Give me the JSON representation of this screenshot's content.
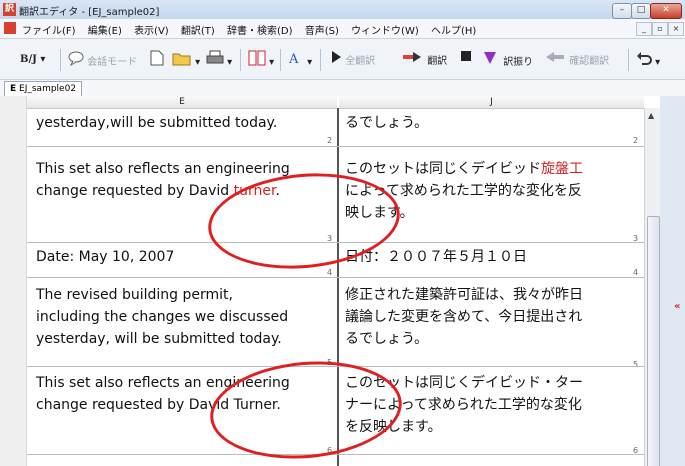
{
  "window": {
    "title": "翻訳エディタ - [EJ_sample02]"
  },
  "menu": [
    "ファイル(F)",
    "編集(E)",
    "表示(V)",
    "翻訳(T)",
    "辞書・検索(D)",
    "音声(S)",
    "ウィンドウ(W)",
    "ヘルプ(H)"
  ],
  "toolbar": {
    "mode": "B/J",
    "conversation_mode": "会話モード",
    "translate_all": "全翻訳",
    "translate": "翻訳",
    "assign": "訳振り",
    "confirm_translate": "確認翻訳"
  },
  "tab": {
    "label": "EJ_sample02"
  },
  "columns": {
    "left": "E",
    "right": "J"
  },
  "rows": [
    {
      "no_top": "",
      "no_bottom": "2",
      "en": [
        "yesterday,will be submitted today."
      ],
      "jp": [
        "るでしょう。"
      ]
    },
    {
      "no_bottom": "3",
      "en_pre": [
        "This set also reflects an engineering",
        "change requested by David "
      ],
      "en_red": "turner",
      "en_post": ".",
      "jp_l1_pre": "このセットは同じくデイビッド",
      "jp_l1_red": "旋盤工",
      "jp_rest": [
        "によって求められた工学的な変化を反",
        "映します。"
      ]
    },
    {
      "no_bottom": "4",
      "en": [
        "Date: May 10, 2007"
      ],
      "jp": [
        "日付：２００７年５月１０日"
      ]
    },
    {
      "no_bottom": "5",
      "en": [
        "The revised building permit,",
        "including the changes we discussed",
        "yesterday, will be submitted today."
      ],
      "jp": [
        "修正された建築許可証は、我々が昨日",
        "議論した変更を含めて、今日提出され",
        "るでしょう。"
      ]
    },
    {
      "no_bottom": "6",
      "en": [
        "This set also reflects an engineering",
        "change requested by David Turner."
      ],
      "jp": [
        "このセットは同じくデイビッド・ター",
        "ナーによって求められた工学的な変化",
        "を反映します。"
      ]
    }
  ],
  "colors": {
    "highlight_red": "#d32424",
    "circle_red": "#e02020"
  }
}
